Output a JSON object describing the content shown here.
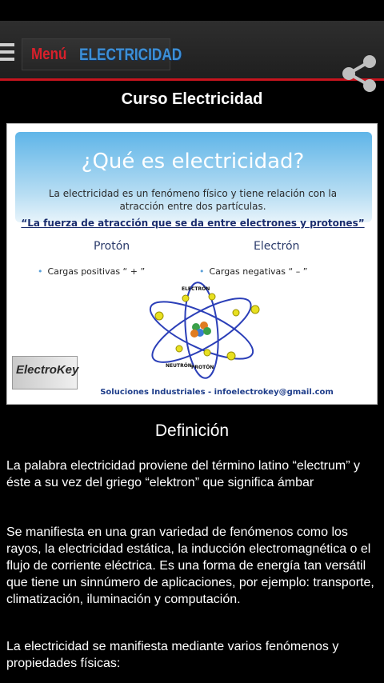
{
  "action_bar": {
    "menu_label": "Menú",
    "brand_label": "ELECTRICIDAD",
    "share_icon": "share-icon"
  },
  "page_title": "Curso Electricidad",
  "figure": {
    "title": "¿Qué es electricidad?",
    "line1": "La electricidad es un fenómeno físico y tiene relación con la",
    "line2": "atracción entre dos partículas.",
    "quote": "“La fuerza de atracción que se da entre electrones y protones”",
    "col_left": "Protón",
    "col_right": "Electrón",
    "charge_left": "Cargas positivas “ + ”",
    "charge_right": "Cargas negativas “ – ”",
    "label_electron": "ELECTRÓN",
    "label_neutron": "NEUTRÓN",
    "label_proton": "PROTÓN",
    "logo_text": "ElectroKey",
    "footer": "Soluciones Industriales - infoelectrokey@gmail.com"
  },
  "section_title": "Definición",
  "paragraphs": [
    "La palabra electricidad proviene del término latino “electrum” y éste a su vez del griego “elektron” que significa ámbar",
    "Se manifiesta en una gran variedad de fenómenos como los rayos, la electricidad estática, la inducción electromagnética o el flujo de corriente eléctrica. Es una forma de energía tan versátil que tiene un sinnúmero de aplicaciones, por ejemplo: transporte, climatización, iluminación y computación.",
    "La electricidad se manifiesta mediante varios fenómenos y propiedades físicas:"
  ],
  "colors": {
    "accent_red": "#c8141e",
    "brand_blue": "#3d8fd6"
  }
}
